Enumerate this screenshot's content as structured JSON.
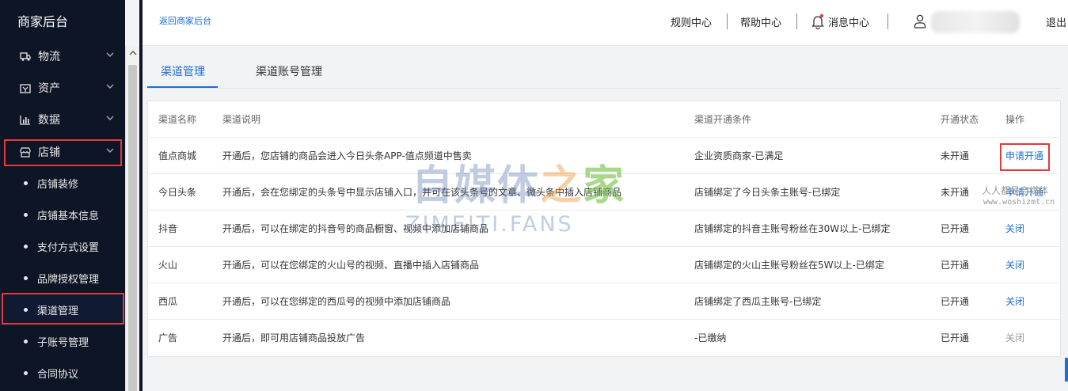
{
  "sidebar": {
    "title": "商家后台",
    "groups": [
      {
        "label": "物流",
        "icon": "truck-icon"
      },
      {
        "label": "资产",
        "icon": "wallet-icon"
      },
      {
        "label": "数据",
        "icon": "bar-chart-icon"
      },
      {
        "label": "店铺",
        "icon": "store-icon"
      }
    ],
    "sub_items": [
      {
        "label": "店铺装修"
      },
      {
        "label": "店铺基本信息"
      },
      {
        "label": "支付方式设置"
      },
      {
        "label": "品牌授权管理"
      },
      {
        "label": "渠道管理",
        "active": true
      },
      {
        "label": "子账号管理"
      },
      {
        "label": "合同协议"
      }
    ]
  },
  "header": {
    "back_link": "返回商家后台",
    "nav": [
      "规则中心",
      "帮助中心",
      "消息中心"
    ],
    "logout": "退出"
  },
  "tabs": [
    {
      "label": "渠道管理",
      "active": true
    },
    {
      "label": "渠道账号管理",
      "active": false
    }
  ],
  "table": {
    "columns": [
      "渠道名称",
      "渠道说明",
      "渠道开通条件",
      "开通状态",
      "操作"
    ],
    "rows": [
      {
        "name": "值点商城",
        "desc": "开通后，您店铺的商品会进入今日头条APP-值点频道中售卖",
        "cond": "企业资质商家-已满足",
        "status": "未开通",
        "op": "申请开通",
        "op_state": "active"
      },
      {
        "name": "今日头条",
        "desc": "开通后，会在您绑定的头条号中显示店铺入口，并可在该头条号的文章、微头条中插入店铺商品",
        "cond": "店铺绑定了今日头条主账号-已绑定",
        "status": "未开通",
        "op": "申请开通",
        "op_state": "active"
      },
      {
        "name": "抖音",
        "desc": "开通后，可以在绑定的抖音号的商品橱窗、视频中添加店铺商品",
        "cond": "店铺绑定的抖音主账号粉丝在30W以上-已绑定",
        "status": "已开通",
        "op": "关闭",
        "op_state": "active"
      },
      {
        "name": "火山",
        "desc": "开通后，可以在您绑定的火山号的视频、直播中插入店铺商品",
        "cond": "店铺绑定的火山主账号粉丝在5W以上-已绑定",
        "status": "已开通",
        "op": "关闭",
        "op_state": "active"
      },
      {
        "name": "西瓜",
        "desc": "开通后，可以在您绑定的西瓜号的视频中添加店铺商品",
        "cond": "店铺绑定了西瓜主账号-已绑定",
        "status": "已开通",
        "op": "关闭",
        "op_state": "active"
      },
      {
        "name": "广告",
        "desc": "开通后，即可用店铺商品投放广告",
        "cond": "-已缴纳",
        "status": "已开通",
        "op": "关闭",
        "op_state": "disabled"
      }
    ]
  },
  "watermarks": {
    "main_a": "自媒体",
    "main_b": "之",
    "main_c": "家",
    "latin": "ZIMEITI.FANS",
    "side_cn": "人人都是自媒体",
    "side_url": "www.woshizmt.cn"
  },
  "colors": {
    "sidebar_bg": "#0e1526",
    "accent": "#1f6fd1",
    "highlight": "#e03a3a"
  }
}
